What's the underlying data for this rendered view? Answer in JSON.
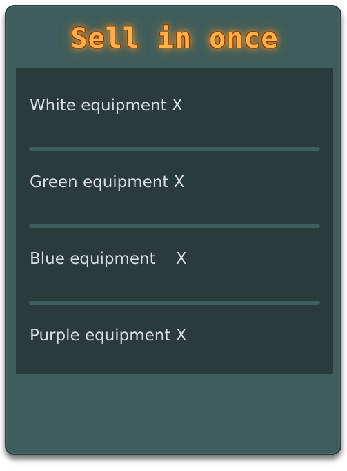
{
  "title": "Sell in once",
  "items": [
    {
      "label": "White equipment X"
    },
    {
      "label": "Green equipment X"
    },
    {
      "label": "Blue equipment    X"
    },
    {
      "label": "Purple equipment X"
    }
  ]
}
